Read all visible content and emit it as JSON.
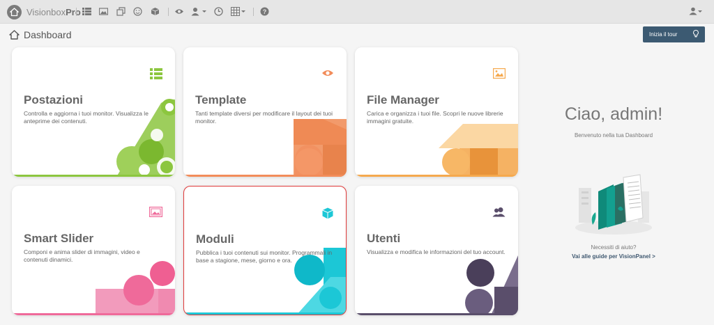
{
  "app": {
    "brand_light": "Visionbox",
    "brand_bold": "Pro"
  },
  "toolbar": {
    "icons": [
      "list-icon",
      "image-icon",
      "copy-icon",
      "smile-icon",
      "box-icon",
      "eye-icon",
      "user-add-icon",
      "clock-icon",
      "grid-icon",
      "help-icon"
    ],
    "user_icon": "user-icon"
  },
  "header": {
    "title": "Dashboard",
    "tour_button": "Inizia il tour"
  },
  "cards": [
    {
      "title": "Postazioni",
      "description": "Controlla e aggiorna i tuoi monitor. Visualizza le anteprime dei contenuti.",
      "icon": "list-grid-icon",
      "color": "#8cc63f"
    },
    {
      "title": "Template",
      "description": "Tanti template diversi per modificare il layout dei tuoi monitor.",
      "icon": "eye-icon",
      "color": "#f28c5a"
    },
    {
      "title": "File Manager",
      "description": "Carica e organizza i tuoi file. Scopri le nuove librerie immagini gratuite.",
      "icon": "image-icon",
      "color": "#f5a94e"
    },
    {
      "title": "Smart Slider",
      "description": "Componi e anima slider di immagini, video e contenuti dinamici.",
      "icon": "gallery-icon",
      "color": "#ef6a9a"
    },
    {
      "title": "Moduli",
      "description": "Pubblica i tuoi contenuti sui monitor. Programmali in base a stagione, mese, giorno e ora.",
      "icon": "cube-icon",
      "color": "#1cc7d6"
    },
    {
      "title": "Utenti",
      "description": "Visualizza e modifica le informazioni del tuo account.",
      "icon": "users-icon",
      "color": "#5a4e6b"
    }
  ],
  "sidebar": {
    "greeting": "Ciao, admin!",
    "welcome": "Benvenuto nella tua Dashboard",
    "help_question": "Necessiti di aiuto?",
    "help_link": "Vai alle guide per VisionPanel >"
  }
}
